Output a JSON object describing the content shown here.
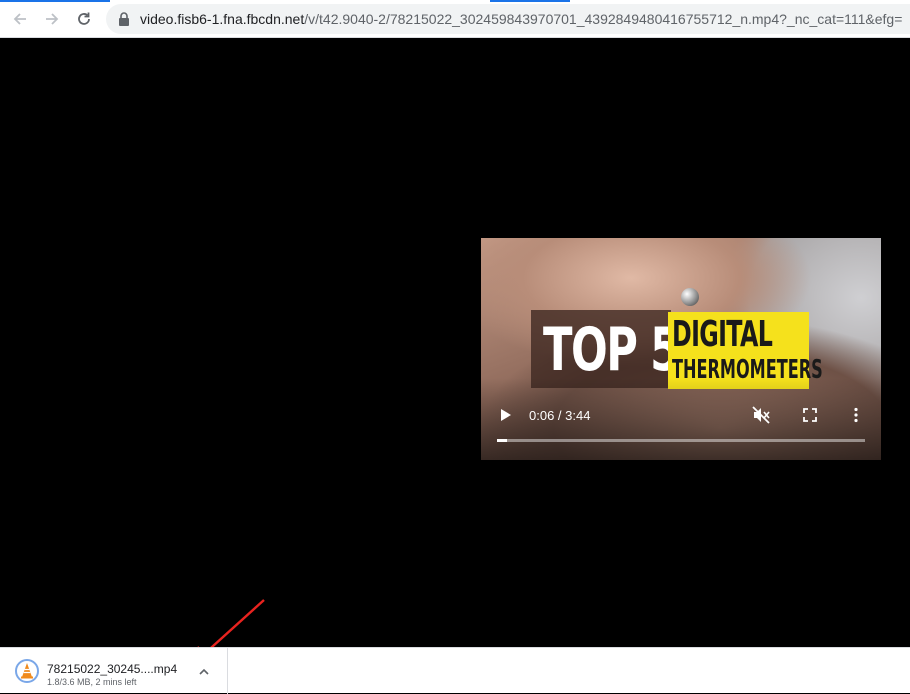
{
  "browser": {
    "url_host": "video.fisb6-1.fna.fbcdn.net",
    "url_path": "/v/t42.9040-2/78215022_302459843970701_4392849480416755712_n.mp4?_nc_cat=111&efg="
  },
  "video": {
    "overlay_title_line1": "TOP 5",
    "overlay_title_line2": "DIGITAL",
    "overlay_title_line3": "THERMOMETERS",
    "time_display": "0:06 / 3:44",
    "progress_fraction": 0.027
  },
  "download": {
    "file_name": "78215022_30245....mp4",
    "status": "1.8/3.6 MB, 2 mins left"
  },
  "colors": {
    "accent": "#1a73e8",
    "arrow": "#e8231f",
    "title_yellow": "#f5e11c"
  }
}
